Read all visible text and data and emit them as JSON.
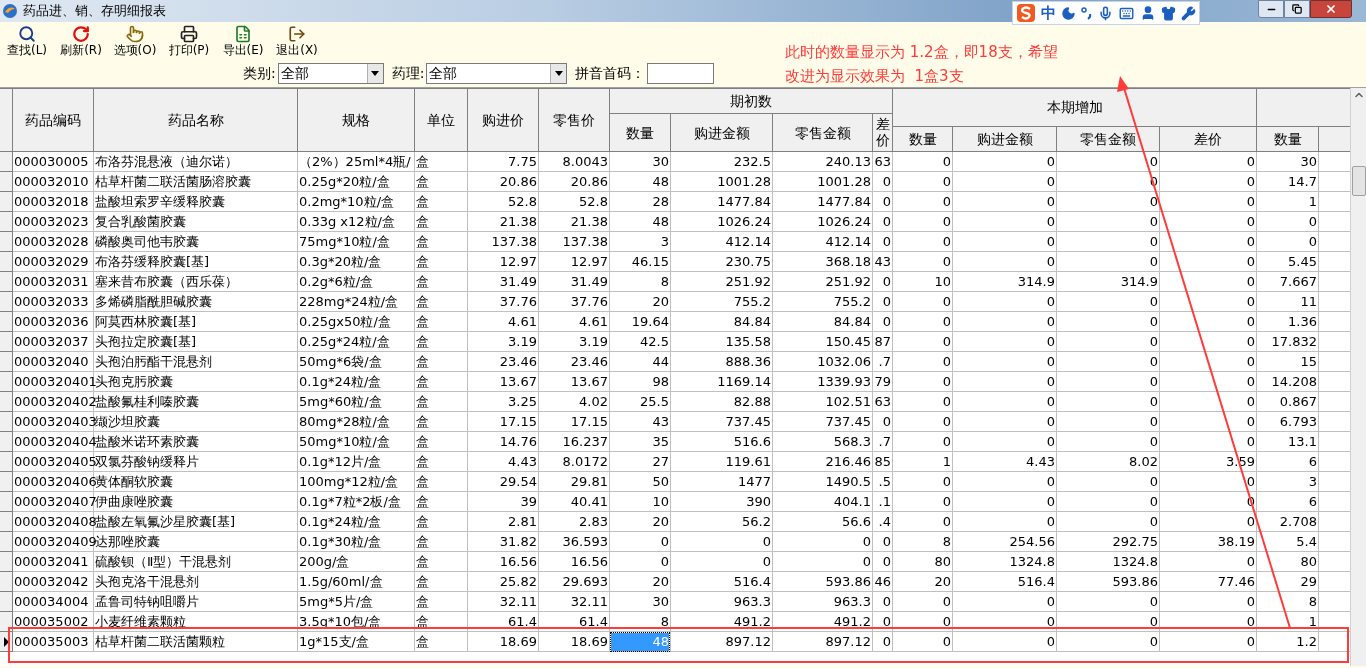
{
  "window": {
    "title": "药品进、销、存明细报表"
  },
  "ime_bar": {
    "mode": "中"
  },
  "toolbar": [
    {
      "label": "查找(L)",
      "kind": "search"
    },
    {
      "label": "刷新(R)",
      "kind": "refresh"
    },
    {
      "label": "选项(O)",
      "kind": "options"
    },
    {
      "label": "打印(P)",
      "kind": "print"
    },
    {
      "label": "导出(E)",
      "kind": "export"
    },
    {
      "label": "退出(X)",
      "kind": "exit"
    }
  ],
  "filters": [
    {
      "label": "类别:",
      "kind": "select",
      "value": "全部"
    },
    {
      "label": "药理:",
      "kind": "select",
      "value": "全部"
    },
    {
      "label": "拼音首码：",
      "kind": "input"
    }
  ],
  "annotation": {
    "lines": [
      "此时的数量显示为 1.2盒，即18支，希望",
      "改进为显示效果为  1盒3支"
    ]
  },
  "table": {
    "column_groups": [
      {
        "label": "期初数"
      },
      {
        "label": "本期增加"
      }
    ],
    "columns": [
      {
        "label": "药品编码",
        "focused": false
      },
      {
        "label": "药品名称",
        "focused": false
      },
      {
        "label": "规格",
        "focused": false
      },
      {
        "label": "单位",
        "focused": false
      },
      {
        "label": "购进价",
        "focused": false
      },
      {
        "label": "零售价",
        "focused": false
      },
      {
        "label": "数量",
        "focused": true
      },
      {
        "label": "购进金额",
        "focused": false
      },
      {
        "label": "零售金额",
        "focused": false
      },
      {
        "label": "差价",
        "focused": false
      },
      {
        "label": "数量",
        "focused": false
      },
      {
        "label": "购进金额",
        "focused": false
      },
      {
        "label": "零售金额",
        "focused": false
      },
      {
        "label": "差价",
        "focused": false
      },
      {
        "label": "数量",
        "focused": false
      }
    ],
    "rows": [
      {
        "selected": false,
        "cells": [
          "000030005",
          "布洛芬混悬液（迪尔诺）",
          "（2%）25ml*4瓶/",
          "盒",
          "7.75",
          "8.0043",
          "30",
          "232.5",
          "240.13",
          "63",
          "0",
          "0",
          "0",
          "0",
          "30"
        ]
      },
      {
        "selected": false,
        "cells": [
          "000032010",
          "枯草杆菌二联活菌肠溶胶囊",
          "0.25g*20粒/盒",
          "盒",
          "20.86",
          "20.86",
          "48",
          "1001.28",
          "1001.28",
          "0",
          "0",
          "0",
          "0",
          "0",
          "14.7"
        ]
      },
      {
        "selected": false,
        "cells": [
          "000032018",
          "盐酸坦索罗辛缓释胶囊",
          "0.2mg*10粒/盒",
          "盒",
          "52.8",
          "52.8",
          "28",
          "1477.84",
          "1477.84",
          "0",
          "0",
          "0",
          "0",
          "0",
          "1"
        ]
      },
      {
        "selected": false,
        "cells": [
          "000032023",
          "复合乳酸菌胶囊",
          "0.33g x12粒/盒",
          "盒",
          "21.38",
          "21.38",
          "48",
          "1026.24",
          "1026.24",
          "0",
          "0",
          "0",
          "0",
          "0",
          "0"
        ]
      },
      {
        "selected": false,
        "cells": [
          "000032028",
          "磷酸奥司他韦胶囊",
          "75mg*10粒/盒",
          "盒",
          "137.38",
          "137.38",
          "3",
          "412.14",
          "412.14",
          "0",
          "0",
          "0",
          "0",
          "0",
          "0"
        ]
      },
      {
        "selected": false,
        "cells": [
          "000032029",
          "布洛芬缓释胶囊[基]",
          "0.3g*20粒/盒",
          "盒",
          "12.97",
          "12.97",
          "46.15",
          "230.75",
          "368.18",
          "43",
          "0",
          "0",
          "0",
          "0",
          "5.45"
        ]
      },
      {
        "selected": false,
        "cells": [
          "000032031",
          "塞来昔布胶囊（西乐葆）",
          "0.2g*6粒/盒",
          "盒",
          "31.49",
          "31.49",
          "8",
          "251.92",
          "251.92",
          "0",
          "10",
          "314.9",
          "314.9",
          "0",
          "7.667"
        ]
      },
      {
        "selected": false,
        "cells": [
          "000032033",
          "多烯磷脂酰胆碱胶囊",
          "228mg*24粒/盒",
          "盒",
          "37.76",
          "37.76",
          "20",
          "755.2",
          "755.2",
          "0",
          "0",
          "0",
          "0",
          "0",
          "11"
        ]
      },
      {
        "selected": false,
        "cells": [
          "000032036",
          "阿莫西林胶囊[基]",
          "0.25gx50粒/盒",
          "盒",
          "4.61",
          "4.61",
          "19.64",
          "84.84",
          "84.84",
          "0",
          "0",
          "0",
          "0",
          "0",
          "1.36"
        ]
      },
      {
        "selected": false,
        "cells": [
          "000032037",
          "头孢拉定胶囊[基]",
          "0.25g*24粒/盒",
          "盒",
          "3.19",
          "3.19",
          "42.5",
          "135.58",
          "150.45",
          "87",
          "0",
          "0",
          "0",
          "0",
          "17.832"
        ]
      },
      {
        "selected": false,
        "cells": [
          "000032040",
          "头孢泊肟酯干混悬剂",
          "50mg*6袋/盒",
          "盒",
          "23.46",
          "23.46",
          "44",
          "888.36",
          "1032.06",
          ".7",
          "0",
          "0",
          "0",
          "0",
          "15"
        ]
      },
      {
        "selected": false,
        "cells": [
          "0000320401",
          "头孢克肟胶囊",
          "0.1g*24粒/盒",
          "盒",
          "13.67",
          "13.67",
          "98",
          "1169.14",
          "1339.93",
          "79",
          "0",
          "0",
          "0",
          "0",
          "14.208"
        ]
      },
      {
        "selected": false,
        "cells": [
          "0000320402",
          "盐酸氟桂利嗪胶囊",
          "5mg*60粒/盒",
          "盒",
          "3.25",
          "4.02",
          "25.5",
          "82.88",
          "102.51",
          "63",
          "0",
          "0",
          "0",
          "0",
          "0.867"
        ]
      },
      {
        "selected": false,
        "cells": [
          "0000320403",
          "缬沙坦胶囊",
          "80mg*28粒/盒",
          "盒",
          "17.15",
          "17.15",
          "43",
          "737.45",
          "737.45",
          "0",
          "0",
          "0",
          "0",
          "0",
          "6.793"
        ]
      },
      {
        "selected": false,
        "cells": [
          "0000320404",
          "盐酸米诺环素胶囊",
          "50mg*10粒/盒",
          "盒",
          "14.76",
          "16.237",
          "35",
          "516.6",
          "568.3",
          ".7",
          "0",
          "0",
          "0",
          "0",
          "13.1"
        ]
      },
      {
        "selected": false,
        "cells": [
          "0000320405",
          "双氯芬酸钠缓释片",
          "0.1g*12片/盒",
          "盒",
          "4.43",
          "8.0172",
          "27",
          "119.61",
          "216.46",
          "85",
          "1",
          "4.43",
          "8.02",
          "3.59",
          "6"
        ]
      },
      {
        "selected": false,
        "cells": [
          "0000320406",
          "黄体酮软胶囊",
          "100mg*12粒/盒",
          "盒",
          "29.54",
          "29.81",
          "50",
          "1477",
          "1490.5",
          ".5",
          "0",
          "0",
          "0",
          "0",
          "3"
        ]
      },
      {
        "selected": false,
        "cells": [
          "0000320407",
          "伊曲康唑胶囊",
          "0.1g*7粒*2板/盒",
          "盒",
          "39",
          "40.41",
          "10",
          "390",
          "404.1",
          ".1",
          "0",
          "0",
          "0",
          "0",
          "6"
        ]
      },
      {
        "selected": false,
        "cells": [
          "0000320408",
          "盐酸左氧氟沙星胶囊[基]",
          "0.1g*24粒/盒",
          "盒",
          "2.81",
          "2.83",
          "20",
          "56.2",
          "56.6",
          ".4",
          "0",
          "0",
          "0",
          "0",
          "2.708"
        ]
      },
      {
        "selected": false,
        "cells": [
          "0000320409",
          "达那唑胶囊",
          "0.1g*30粒/盒",
          "盒",
          "31.82",
          "36.593",
          "0",
          "0",
          "0",
          "0",
          "8",
          "254.56",
          "292.75",
          "38.19",
          "5.4"
        ]
      },
      {
        "selected": false,
        "cells": [
          "000032041",
          "硫酸钡（Ⅱ型）干混悬剂",
          "200g/盒",
          "盒",
          "16.56",
          "16.56",
          "0",
          "0",
          "0",
          "0",
          "80",
          "1324.8",
          "1324.8",
          "0",
          "80"
        ]
      },
      {
        "selected": false,
        "cells": [
          "000032042",
          "头孢克洛干混悬剂",
          "1.5g/60ml/盒",
          "盒",
          "25.82",
          "29.693",
          "20",
          "516.4",
          "593.86",
          "46",
          "20",
          "516.4",
          "593.86",
          "77.46",
          "29"
        ]
      },
      {
        "selected": false,
        "cells": [
          "000034004",
          "孟鲁司特钠咀嚼片",
          "5mg*5片/盒",
          "盒",
          "32.11",
          "32.11",
          "30",
          "963.3",
          "963.3",
          "0",
          "0",
          "0",
          "0",
          "0",
          "8"
        ]
      },
      {
        "selected": false,
        "cells": [
          "000035002",
          "小麦纤维素颗粒",
          "3.5g*10包/盒",
          "盒",
          "61.4",
          "61.4",
          "8",
          "491.2",
          "491.2",
          "0",
          "0",
          "0",
          "0",
          "0",
          "1"
        ]
      },
      {
        "selected": true,
        "cells": [
          "000035003",
          "枯草杆菌二联活菌颗粒",
          "1g*15支/盒",
          "盒",
          "18.69",
          "18.69",
          "48",
          "897.12",
          "897.12",
          "0",
          "0",
          "0",
          "0",
          "0",
          "1.2"
        ]
      }
    ]
  }
}
